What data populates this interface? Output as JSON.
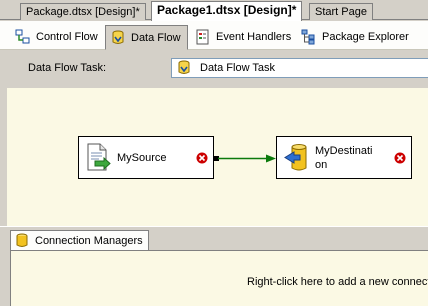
{
  "document_tabs": [
    {
      "label": "Package.dtsx [Design]*",
      "active": false
    },
    {
      "label": "Package1.dtsx [Design]*",
      "active": true
    },
    {
      "label": "Start Page",
      "active": false
    }
  ],
  "designer_tabs": [
    {
      "label": "Control Flow",
      "icon": "control-flow-icon",
      "active": false
    },
    {
      "label": "Data Flow",
      "icon": "data-flow-icon",
      "active": true
    },
    {
      "label": "Event Handlers",
      "icon": "event-handlers-icon",
      "active": false
    },
    {
      "label": "Package Explorer",
      "icon": "package-explorer-icon",
      "active": false
    }
  ],
  "task_selector": {
    "label": "Data Flow Task:",
    "value": "Data Flow Task",
    "icon": "data-flow-task-icon"
  },
  "components": [
    {
      "name": "MySource",
      "icon": "source-document-icon",
      "status": "error"
    },
    {
      "name": "MyDestination",
      "display_lines": [
        "MyDestinati",
        "on"
      ],
      "icon": "destination-database-icon",
      "status": "error"
    }
  ],
  "connection_managers": {
    "tab_label": "Connection Managers",
    "hint": "Right-click here to add a new connect"
  },
  "colors": {
    "canvas": "#fbf9e4",
    "chrome": "#d4d0c8",
    "path_line": "#0b7a0b",
    "error": "#cc0000"
  }
}
